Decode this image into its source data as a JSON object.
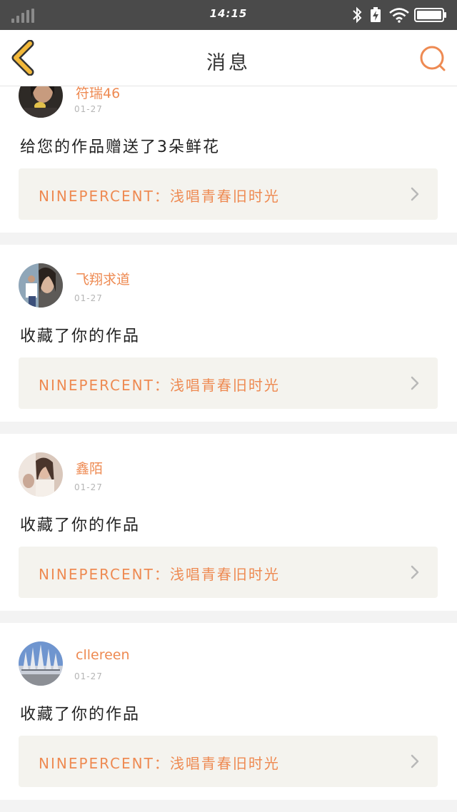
{
  "status_bar": {
    "time": "14:15",
    "icons": [
      "signal-icon",
      "bluetooth-icon",
      "charging-icon",
      "wifi-icon",
      "battery-icon"
    ]
  },
  "header": {
    "title": "消息",
    "back_icon": "back-chevron-icon",
    "search_icon": "search-icon"
  },
  "messages": [
    {
      "name": "符瑞46",
      "date": "01-27",
      "text": "给您的作品赠送了3朵鲜花",
      "work": "NINEPERCENT：浅唱青春旧时光"
    },
    {
      "name": "飞翔求道",
      "date": "01-27",
      "text": "收藏了你的作品",
      "work": "NINEPERCENT：浅唱青春旧时光"
    },
    {
      "name": "鑫陌",
      "date": "01-27",
      "text": "收藏了你的作品",
      "work": "NINEPERCENT：浅唱青春旧时光"
    },
    {
      "name": "cllereen",
      "date": "01-27",
      "text": "收藏了你的作品",
      "work": "NINEPERCENT：浅唱青春旧时光"
    }
  ],
  "colors": {
    "accent": "#ee8a52",
    "back_icon": "#f2b83a",
    "status_bar": "#4a4a4a",
    "card_link_bg": "#f4f3ee",
    "page_bg": "#f3f3f3"
  }
}
